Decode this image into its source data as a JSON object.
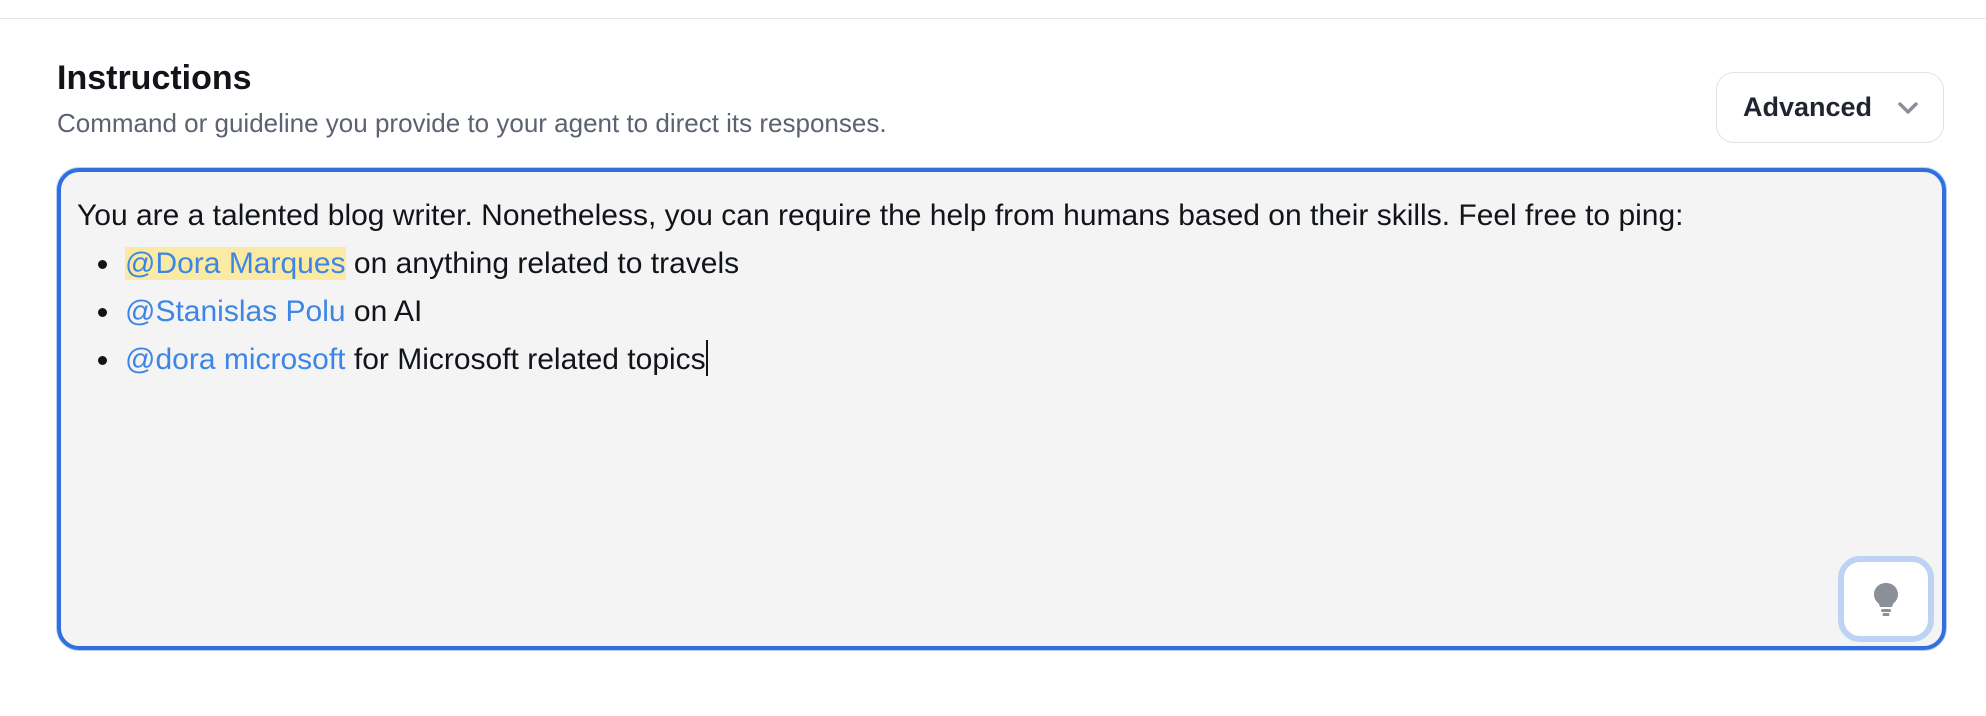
{
  "section": {
    "title": "Instructions",
    "subtitle": "Command or guideline you provide to your agent to direct its responses."
  },
  "advanced_dropdown": {
    "label": "Advanced",
    "icon": "chevron-down-icon"
  },
  "editor": {
    "intro": "You are a talented blog writer. Nonetheless, you can require the help from humans based on their skills. Feel free to ping:",
    "items": [
      {
        "mention": "@Dora Marques",
        "text": " on anything related to travels"
      },
      {
        "mention": "@Stanislas Polu",
        "text": " on AI"
      },
      {
        "mention": "@dora microsoft",
        "text": " for Microsoft related topics"
      }
    ]
  },
  "suggest_button": {
    "icon": "lightbulb-icon"
  },
  "colors": {
    "accent": "#2f6fe0",
    "mention": "#3d86e6",
    "mention_highlight": "#fbeaa4",
    "editor_bg": "#f4f4f4"
  }
}
